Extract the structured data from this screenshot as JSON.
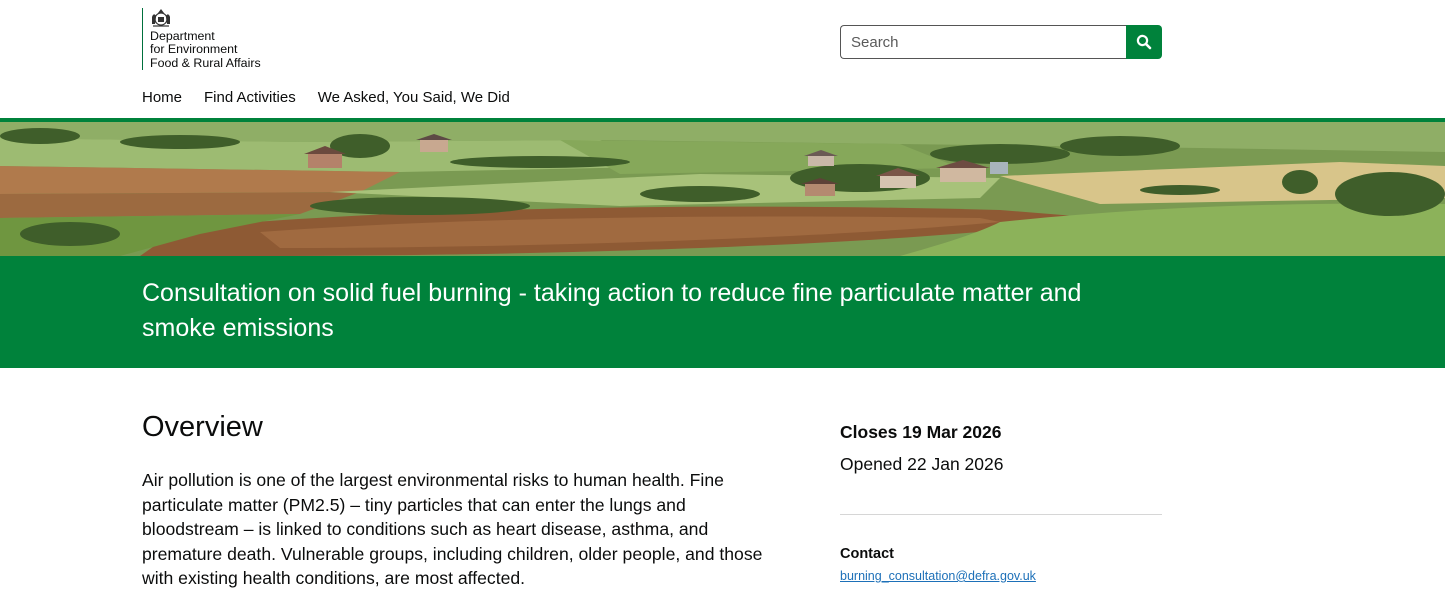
{
  "header": {
    "logo_lines": [
      "Department",
      "for Environment",
      "Food & Rural Affairs"
    ],
    "logo_icon": "royal-crest-icon",
    "search": {
      "placeholder": "Search",
      "value": "",
      "button_icon": "search-icon"
    }
  },
  "nav": {
    "items": [
      {
        "label": "Home"
      },
      {
        "label": "Find Activities"
      },
      {
        "label": "We Asked, You Said, We Did"
      }
    ]
  },
  "colors": {
    "brand_green": "#00823b",
    "link_blue": "#1d70b8"
  },
  "hero": {
    "image": "countryside-landscape"
  },
  "title": "Consultation on solid fuel burning - taking action to reduce fine particulate matter and smoke emissions",
  "main": {
    "heading": "Overview",
    "paragraph": "Air pollution is one of the largest environmental risks to human health. Fine particulate matter (PM2.5) – tiny particles that can enter the lungs and bloodstream – is linked to conditions such as heart disease, asthma, and premature death. Vulnerable groups, including children, older people, and those with existing health conditions, are most affected."
  },
  "aside": {
    "closes": "Closes 19 Mar 2026",
    "opened": "Opened 22 Jan 2026",
    "contact_heading": "Contact",
    "contact_email": "burning_consultation@defra.gov.uk"
  }
}
